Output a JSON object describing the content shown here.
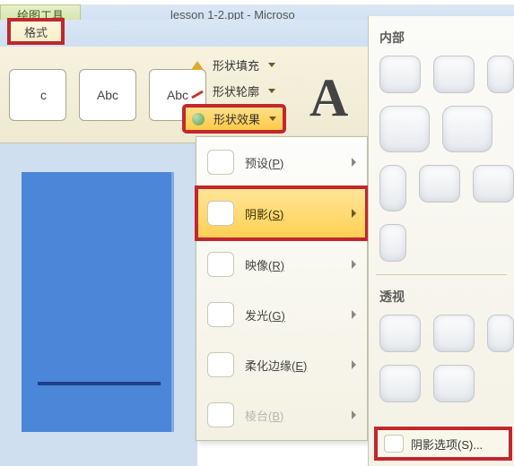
{
  "title_bar": {
    "doc_title": "lesson 1-2.ppt - Microso",
    "drawing_tools": "绘图工具"
  },
  "tabs": {
    "format": "格式"
  },
  "shape_styles": {
    "swatch_partial": "c",
    "swatch1": "Abc",
    "swatch2": "Abc"
  },
  "shape_menu": {
    "fill": "形状填充",
    "outline": "形状轮廓",
    "effects": "形状效果"
  },
  "wordart_sample": "A",
  "effects_menu": {
    "preset": {
      "label": "预设",
      "accel": "(P)"
    },
    "shadow": {
      "label": "阴影",
      "accel": "(S)"
    },
    "reflection": {
      "label": "映像",
      "accel": "(R)"
    },
    "glow": {
      "label": "发光",
      "accel": "(G)"
    },
    "soft_edges": {
      "label": "柔化边缘",
      "accel": "(E)"
    },
    "bevel": {
      "label": "棱台",
      "accel": "(B)"
    }
  },
  "side_panel": {
    "inner_label": "内部",
    "perspective_label": "透视",
    "shadow_options": "阴影选项(S)..."
  }
}
